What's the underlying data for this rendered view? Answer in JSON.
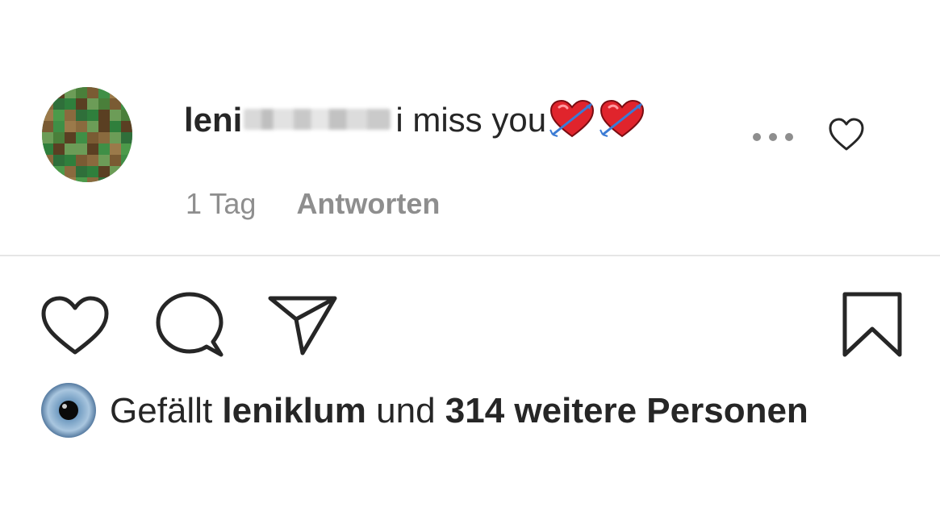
{
  "comment": {
    "username_visible": "leni",
    "text": "i miss you",
    "emoji_icons": [
      "heart-with-arrow-icon",
      "heart-with-arrow-icon"
    ],
    "time": "1 Tag",
    "reply_label": "Antworten",
    "more_icon": "more-dots-icon",
    "like_icon": "heart-outline-icon"
  },
  "actions": {
    "like_icon": "heart-outline-icon",
    "comment_icon": "comment-bubble-icon",
    "share_icon": "paper-plane-icon",
    "save_icon": "bookmark-icon"
  },
  "likes": {
    "prefix": "Gefällt",
    "user": "leniklum",
    "connector": "und",
    "count_text": "314 weitere Personen",
    "avatar_icon": "eye-avatar-icon"
  },
  "colors": {
    "text": "#262626",
    "meta": "#8e8e8e",
    "divider": "#e6e6e6",
    "emoji_red": "#e0242c"
  }
}
